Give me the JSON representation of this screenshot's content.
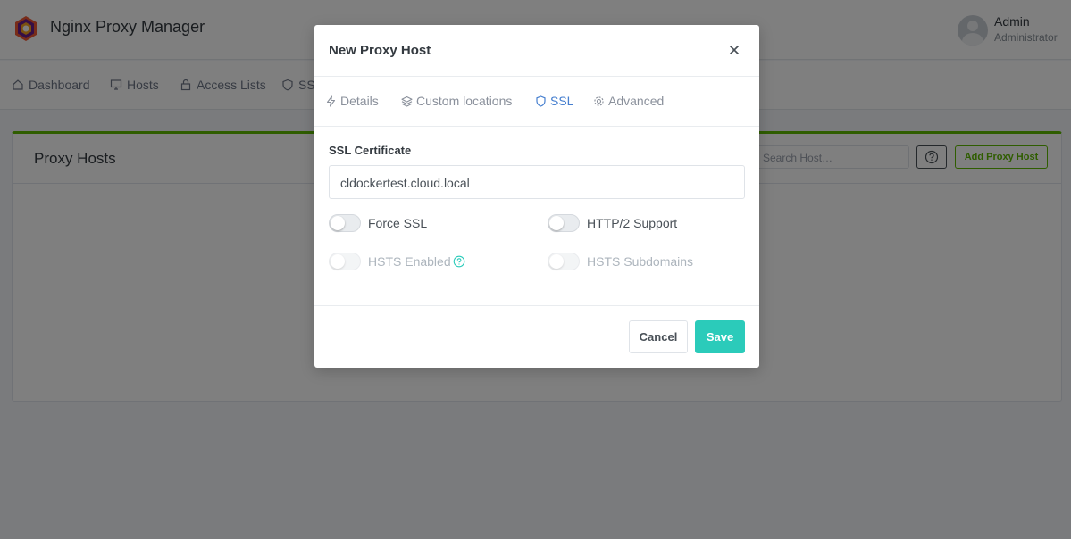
{
  "app": {
    "title": "Nginx Proxy Manager",
    "logo_icon": "npm-logo-icon"
  },
  "user": {
    "name": "Admin",
    "role": "Administrator"
  },
  "nav": {
    "items": [
      {
        "label": "Dashboard",
        "icon": "home-icon"
      },
      {
        "label": "Hosts",
        "icon": "monitor-icon"
      },
      {
        "label": "Access Lists",
        "icon": "lock-icon"
      },
      {
        "label": "SSL",
        "icon": "shield-icon"
      }
    ]
  },
  "card": {
    "title": "Proxy Hosts",
    "search_placeholder": "Search Host…",
    "add_button": "Add Proxy Host",
    "accent_color": "#5eba00"
  },
  "modal": {
    "title": "New Proxy Host",
    "tabs": [
      {
        "label": "Details",
        "icon": "bolt-icon"
      },
      {
        "label": "Custom locations",
        "icon": "layers-icon"
      },
      {
        "label": "SSL",
        "icon": "shield-icon",
        "active": true
      },
      {
        "label": "Advanced",
        "icon": "gear-icon"
      }
    ],
    "ssl": {
      "certificate_label": "SSL Certificate",
      "certificate_value": "cldockertest.cloud.local",
      "toggles": [
        {
          "label": "Force SSL",
          "on": false,
          "disabled": false
        },
        {
          "label": "HTTP/2 Support",
          "on": false,
          "disabled": false
        },
        {
          "label": "HSTS Enabled",
          "on": false,
          "disabled": true
        },
        {
          "label": "HSTS Subdomains",
          "on": false,
          "disabled": true
        }
      ]
    },
    "buttons": {
      "cancel": "Cancel",
      "save": "Save"
    },
    "colors": {
      "active_tab": "#467fcf",
      "save": "#2bcbba"
    }
  }
}
